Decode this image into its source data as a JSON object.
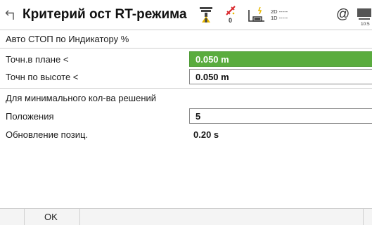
{
  "header": {
    "title": "Критерий ост RT-режима",
    "satellites": {
      "count": "0"
    },
    "position_status": {
      "line1": "2D -----",
      "line2": "1D -----"
    },
    "clock": "10:5"
  },
  "rows": {
    "auto_stop_label": "Авто СТОП по Индикатору %",
    "hz_precision": {
      "label": "Точн.в плане <",
      "value": "0.050 m"
    },
    "height_precision": {
      "label": "Точн по высоте <",
      "value": "0.050 m"
    },
    "min_solutions_label": "Для минимального кол-ва решений",
    "positions": {
      "label": "Положения",
      "value": "5"
    },
    "update": {
      "label": "Обновление позиц.",
      "value": "0.20 s"
    }
  },
  "footer": {
    "ok_label": "OK"
  },
  "colors": {
    "active_field": "#5aac3e",
    "accent_red": "#d9262a",
    "accent_yellow": "#e8b800"
  }
}
